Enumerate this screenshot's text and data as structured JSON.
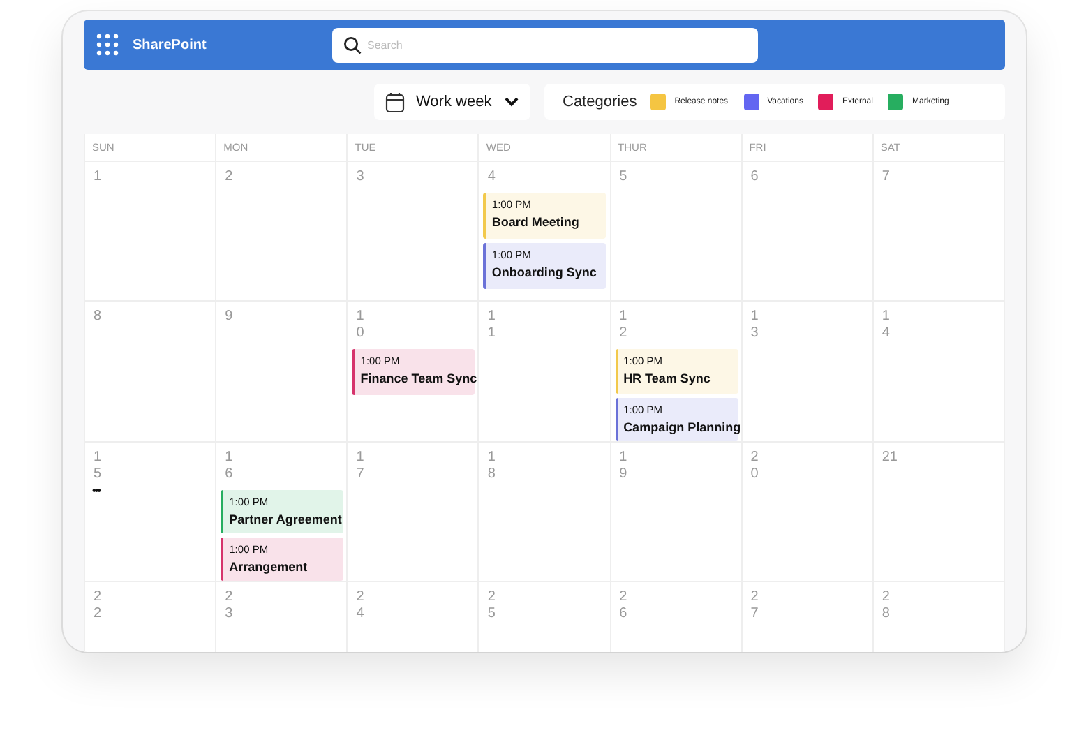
{
  "app": {
    "title": "SharePoint"
  },
  "search": {
    "placeholder": "Search"
  },
  "view": {
    "label": "Work week"
  },
  "categories": {
    "label": "Categories",
    "items": [
      {
        "name": "Release notes",
        "color": "#f5c542"
      },
      {
        "name": "Vacations",
        "color": "#6366f1"
      },
      {
        "name": "External",
        "color": "#e11d5a"
      },
      {
        "name": "Marketing",
        "color": "#27ae60"
      }
    ]
  },
  "calendar": {
    "weekdays": [
      "SUN",
      "MON",
      "TUE",
      "WED",
      "THUR",
      "FRI",
      "SAT"
    ],
    "weeks": [
      {
        "days": [
          {
            "date": "1"
          },
          {
            "date": "2"
          },
          {
            "date": "3"
          },
          {
            "date": "4",
            "events": [
              {
                "time": "1:00 PM",
                "title": "Board Meeting",
                "color": "#f2c94c"
              },
              {
                "time": "1:00 PM",
                "title": "Onboarding Sync",
                "color": "#6b72d8"
              }
            ]
          },
          {
            "date": "5"
          },
          {
            "date": "6"
          },
          {
            "date": "7"
          }
        ]
      },
      {
        "days": [
          {
            "date": "8"
          },
          {
            "date": "9"
          },
          {
            "date": "10",
            "wrapped": true,
            "events": [
              {
                "time": "1:00 PM",
                "title": "Finance Team Sync",
                "color": "#d6336c"
              }
            ]
          },
          {
            "date": "11",
            "wrapped": true
          },
          {
            "date": "12",
            "wrapped": true,
            "events": [
              {
                "time": "1:00 PM",
                "title": "HR Team Sync",
                "color": "#f2c94c"
              },
              {
                "time": "1:00 PM",
                "title": "Campaign Planning",
                "color": "#6b72d8"
              }
            ]
          },
          {
            "date": "13",
            "wrapped": true
          },
          {
            "date": "14",
            "wrapped": true
          }
        ]
      },
      {
        "days": [
          {
            "date": "15",
            "wrapped": true,
            "more": "•••"
          },
          {
            "date": "16",
            "wrapped": true,
            "events": [
              {
                "time": "1:00 PM",
                "title": "Partner Agreement",
                "color": "#27ae60"
              },
              {
                "time": "1:00 PM",
                "title": "Arrangement",
                "color": "#d6336c"
              }
            ]
          },
          {
            "date": "17",
            "wrapped": true
          },
          {
            "date": "18",
            "wrapped": true
          },
          {
            "date": "19",
            "wrapped": true
          },
          {
            "date": "20",
            "wrapped": true
          },
          {
            "date": "21",
            "wrapped": false
          }
        ]
      },
      {
        "days": [
          {
            "date": "22",
            "wrapped": true
          },
          {
            "date": "23",
            "wrapped": true
          },
          {
            "date": "24",
            "wrapped": true
          },
          {
            "date": "25",
            "wrapped": true
          },
          {
            "date": "26",
            "wrapped": true
          },
          {
            "date": "27",
            "wrapped": true
          },
          {
            "date": "28",
            "wrapped": true
          }
        ]
      }
    ]
  }
}
